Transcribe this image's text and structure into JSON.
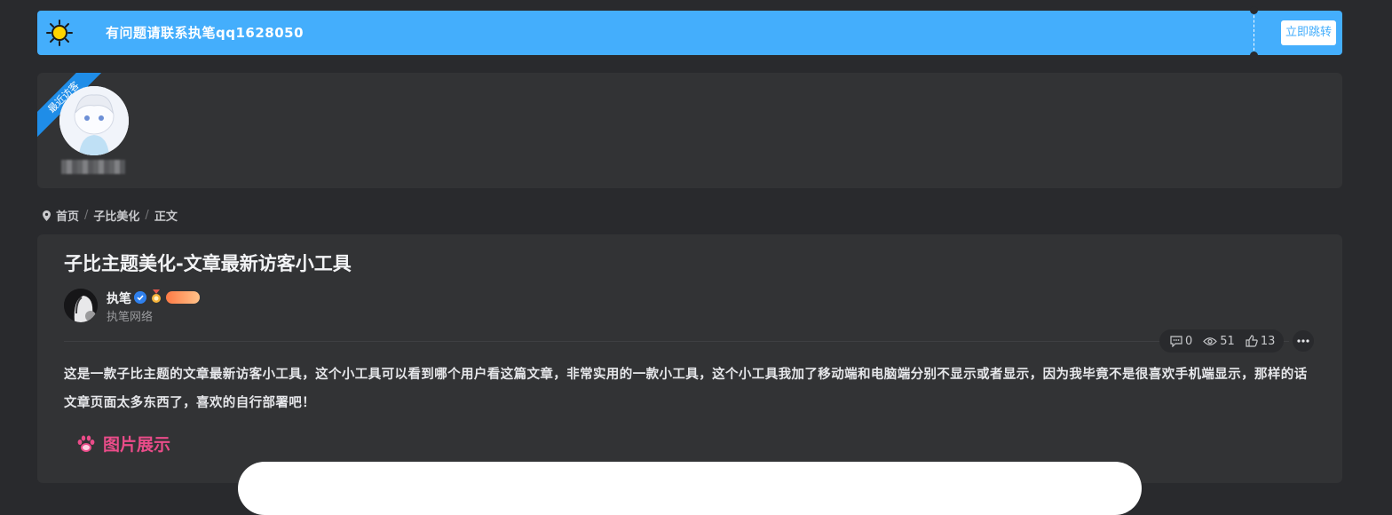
{
  "banner": {
    "text": "有问题请联系执笔qq1628050",
    "button_label": "立即跳转",
    "color": "#44aefc"
  },
  "visitors": {
    "ribbon_label": "最近访客"
  },
  "breadcrumb": {
    "items": [
      "首页",
      "子比美化",
      "正文"
    ]
  },
  "article": {
    "title": "子比主题美化-文章最新访客小工具",
    "author": {
      "name": "执笔",
      "description": "执笔网络"
    },
    "stats": {
      "comments": "0",
      "views": "51",
      "likes": "13"
    },
    "body": "这是一款子比主题的文章最新访客小工具，这个小工具可以看到哪个用户看这篇文章，非常实用的一款小工具，这个小工具我加了移动端和电脑端分别不显示或者显示，因为我毕竟不是很喜欢手机端显示，那样的话文章页面太多东西了，喜欢的自行部署吧！",
    "section_title": "图片展示"
  },
  "colors": {
    "accent": "#44aefc",
    "section_title": "#ea4c89",
    "ribbon": "#1f8de8"
  }
}
